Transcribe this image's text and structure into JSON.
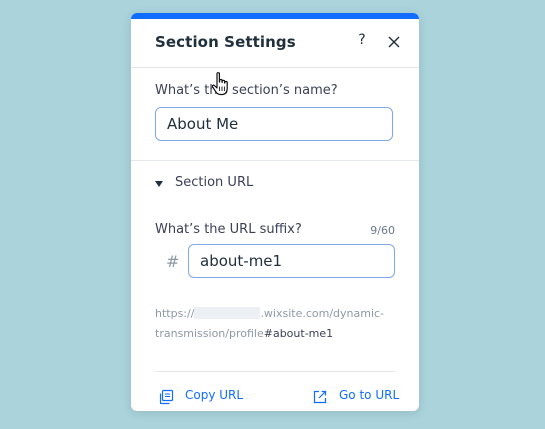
{
  "panel": {
    "title": "Section Settings",
    "help_label": "?",
    "accent_color": "#116dff"
  },
  "name_section": {
    "label": "What’s this section’s name?",
    "value": "About Me"
  },
  "url_section": {
    "toggle_label": "Section URL",
    "suffix_label": "What’s the URL suffix?",
    "counter": "9/60",
    "hash_symbol": "#",
    "suffix_value": "about-me1",
    "preview": {
      "prefix": "https://",
      "domain_suffix": ".wixsite.com/dynamic-",
      "path": "transmission/profile",
      "anchor": "#about-me1"
    }
  },
  "footer": {
    "copy_label": "Copy URL",
    "goto_label": "Go to URL"
  },
  "icons": [
    "question-mark-icon",
    "close-icon",
    "caret-down-icon",
    "copy-icon",
    "external-link-icon",
    "hand-pointer-icon"
  ]
}
